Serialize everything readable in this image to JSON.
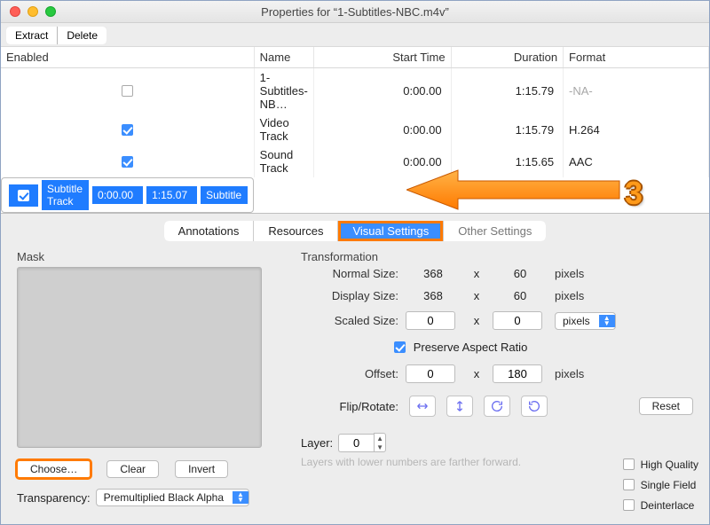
{
  "window": {
    "title": "Properties for “1-Subtitles-NBC.m4v”"
  },
  "toolbar": {
    "extract": "Extract",
    "delete": "Delete"
  },
  "table": {
    "headers": {
      "enabled": "Enabled",
      "name": "Name",
      "start": "Start Time",
      "duration": "Duration",
      "format": "Format"
    },
    "rows": [
      {
        "enabled": false,
        "name": "1-Subtitles-NB…",
        "start": "0:00.00",
        "duration": "1:15.79",
        "format": "-NA-",
        "na": true
      },
      {
        "enabled": true,
        "name": "Video Track",
        "start": "0:00.00",
        "duration": "1:15.79",
        "format": "H.264"
      },
      {
        "enabled": true,
        "name": "Sound Track",
        "start": "0:00.00",
        "duration": "1:15.65",
        "format": "AAC"
      },
      {
        "enabled": true,
        "name": "Subtitle Track",
        "start": "0:00.00",
        "duration": "1:15.07",
        "format": "Subtitle",
        "selected": true
      }
    ]
  },
  "tabs": {
    "items": [
      "Annotations",
      "Resources",
      "Visual Settings",
      "Other Settings"
    ],
    "active": 2
  },
  "mask": {
    "label": "Mask",
    "choose": "Choose…",
    "clear": "Clear",
    "invert": "Invert"
  },
  "transparency": {
    "label": "Transparency:",
    "value": "Premultiplied Black Alpha"
  },
  "transformation": {
    "label": "Transformation",
    "normal": {
      "label": "Normal Size:",
      "w": "368",
      "h": "60",
      "unit": "pixels"
    },
    "display": {
      "label": "Display Size:",
      "w": "368",
      "h": "60",
      "unit": "pixels"
    },
    "scaled": {
      "label": "Scaled Size:",
      "w": "0",
      "h": "0",
      "unit": "pixels"
    },
    "preserve_label": "Preserve Aspect Ratio",
    "preserve_checked": true,
    "offset": {
      "label": "Offset:",
      "x": "0",
      "y": "180",
      "unit": "pixels"
    },
    "flip_label": "Flip/Rotate:",
    "reset": "Reset",
    "layer_label": "Layer:",
    "layer_value": "0",
    "layer_hint": "Layers with lower numbers are farther forward.",
    "quality": {
      "high": "High Quality",
      "single": "Single Field",
      "deint": "Deinterlace"
    }
  },
  "annotation": {
    "step": "3"
  }
}
